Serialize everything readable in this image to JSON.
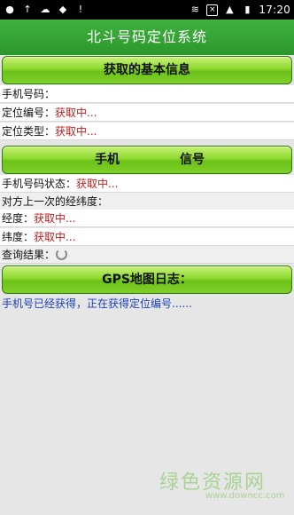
{
  "status_bar": {
    "time": "17:20",
    "icons": [
      "dot-icon",
      "upload-icon",
      "cloud-icon",
      "android-icon",
      "alert-icon",
      "wifi-icon",
      "close-box-icon",
      "signal-icon",
      "battery-icon"
    ]
  },
  "title": "北斗号码定位系统",
  "section_basic": {
    "label": "获取的基本信息"
  },
  "rows_basic": {
    "phone_label": "手机号码：",
    "locno_label": "定位编号：",
    "locno_value": "获取中...",
    "loctype_label": "定位类型：",
    "loctype_value": "获取中..."
  },
  "section_signal": {
    "label_a": "手机",
    "label_b": "信号"
  },
  "rows_signal": {
    "status_label": "手机号码状态：",
    "status_value": "获取中...",
    "lastpos_label": "对方上一次的经纬度：",
    "lon_label": "经度：",
    "lon_value": "获取中...",
    "lat_label": "纬度：",
    "lat_value": "获取中...",
    "query_label": "查询结果："
  },
  "section_gps": {
    "label": "GPS地图日志："
  },
  "log_text": "手机号已经获得，正在获得定位编号......",
  "watermark": {
    "text": "绿色资源网",
    "url": "www.downcc.com"
  },
  "colors": {
    "title_green": "#2c962c",
    "button_green": "#8ed82f",
    "status_red": "#c41c1c",
    "log_blue": "#1a3fc0"
  }
}
